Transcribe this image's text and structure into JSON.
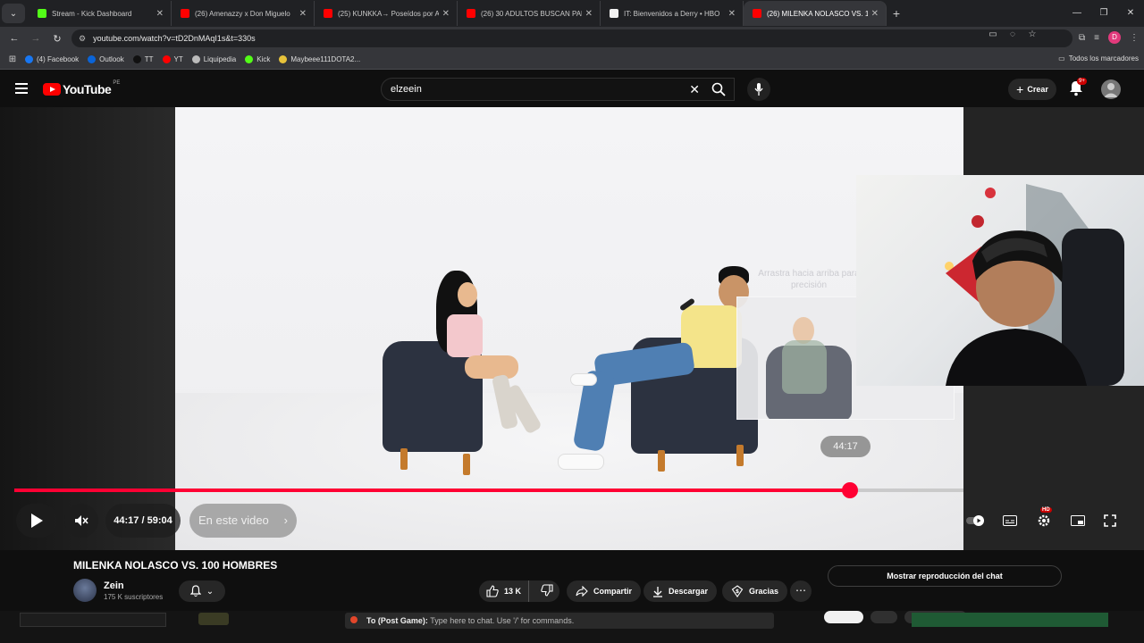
{
  "browser": {
    "tabs": [
      {
        "title": "Stream - Kick Dashboard",
        "color": "#53fc18",
        "active": false
      },
      {
        "title": "(26) Amenazzy x Don Miguelo",
        "color": "#ff0000",
        "active": false
      },
      {
        "title": "(25) KUNKKA→ Poseídos por A",
        "color": "#ff0000",
        "active": false
      },
      {
        "title": "(26) 30 ADULTOS BUSCAN PAR",
        "color": "#ff0000",
        "active": false
      },
      {
        "title": "IT: Bienvenidos a Derry • HBO",
        "color": "#f2f2f2",
        "active": false
      },
      {
        "title": "(26) MILENKA NOLASCO VS. 10",
        "color": "#ff0000",
        "active": true
      }
    ],
    "new_tab": "+",
    "url": "youtube.com/watch?v=tD2DnMAqI1s&t=330s",
    "profile_initial": "D",
    "bookmarks": [
      {
        "label": "(4) Facebook",
        "color": "#1877f2"
      },
      {
        "label": "Outlook",
        "color": "#0a64d8"
      },
      {
        "label": "TT",
        "color": "#111111"
      },
      {
        "label": "YT",
        "color": "#ff0000"
      },
      {
        "label": "Liquipedia",
        "color": "#bbbbbb"
      },
      {
        "label": "Kick",
        "color": "#53fc18"
      },
      {
        "label": "Maybeee111DOTA2...",
        "color": "#e7c23a"
      }
    ],
    "all_bookmarks": "Todos los marcadores"
  },
  "youtube": {
    "logo_text": "YouTube",
    "country": "PE",
    "search_value": "elzeein",
    "create_label": "Crear",
    "notif_badge": "9+",
    "accent": "#ff0033"
  },
  "player": {
    "current_time": "44:17",
    "duration": "59:04",
    "time_display": "44:17 / 59:04",
    "hover_time": "44:17",
    "progress_fraction": 0.88,
    "chapter_label": "En este video",
    "preview_hint": "Arrastra hacia arriba para precisión",
    "hd_badge": "HD"
  },
  "video": {
    "title": "MILENKA NOLASCO VS. 100 HOMBRES",
    "channel": "Zein",
    "subscribers": "175 K suscriptores",
    "likes": "13 K",
    "share_label": "Compartir",
    "download_label": "Descargar",
    "thanks_label": "Gracias",
    "chat_replay_label": "Mostrar reproducción del chat"
  },
  "overlay": {
    "chat_prefix": "To (Post Game):",
    "chat_placeholder": "Type here to chat. Use '/' for commands."
  }
}
